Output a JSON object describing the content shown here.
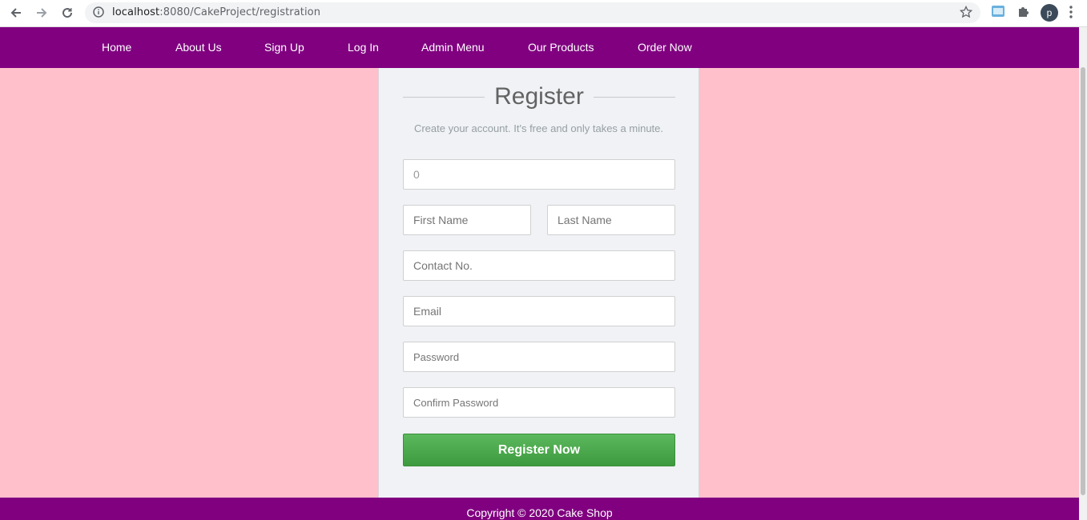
{
  "browser": {
    "url_host": "localhost",
    "url_path": ":8080/CakeProject/registration"
  },
  "nav": {
    "links": [
      "Home",
      "About Us",
      "Sign Up",
      "Log In",
      "Admin Menu",
      "Our Products",
      "Order Now"
    ]
  },
  "form": {
    "title": "Register",
    "subtitle": "Create your account. It's free and only takes a minute.",
    "id_value": "0",
    "first_name_placeholder": "First Name",
    "last_name_placeholder": "Last Name",
    "contact_placeholder": "Contact No.",
    "email_placeholder": "Email",
    "password_placeholder": "Password",
    "confirm_password_placeholder": "Confirm Password",
    "submit_label": "Register Now"
  },
  "footer": {
    "text": "Copyright © 2020 Cake Shop"
  },
  "colors": {
    "page_background": "#ffc0cb",
    "nav_background": "#800080",
    "panel_background": "#f0f2f5",
    "button_green": "#4cae4c"
  },
  "icons": {
    "back": "arrow-left-icon",
    "forward": "arrow-right-icon",
    "reload": "reload-icon",
    "site_info": "info-icon",
    "bookmark": "star-icon",
    "extension_pst": "pst-extension-icon",
    "extensions": "puzzle-icon",
    "profile": "avatar",
    "menu": "kebab-menu-icon"
  },
  "profile_initial": "p"
}
